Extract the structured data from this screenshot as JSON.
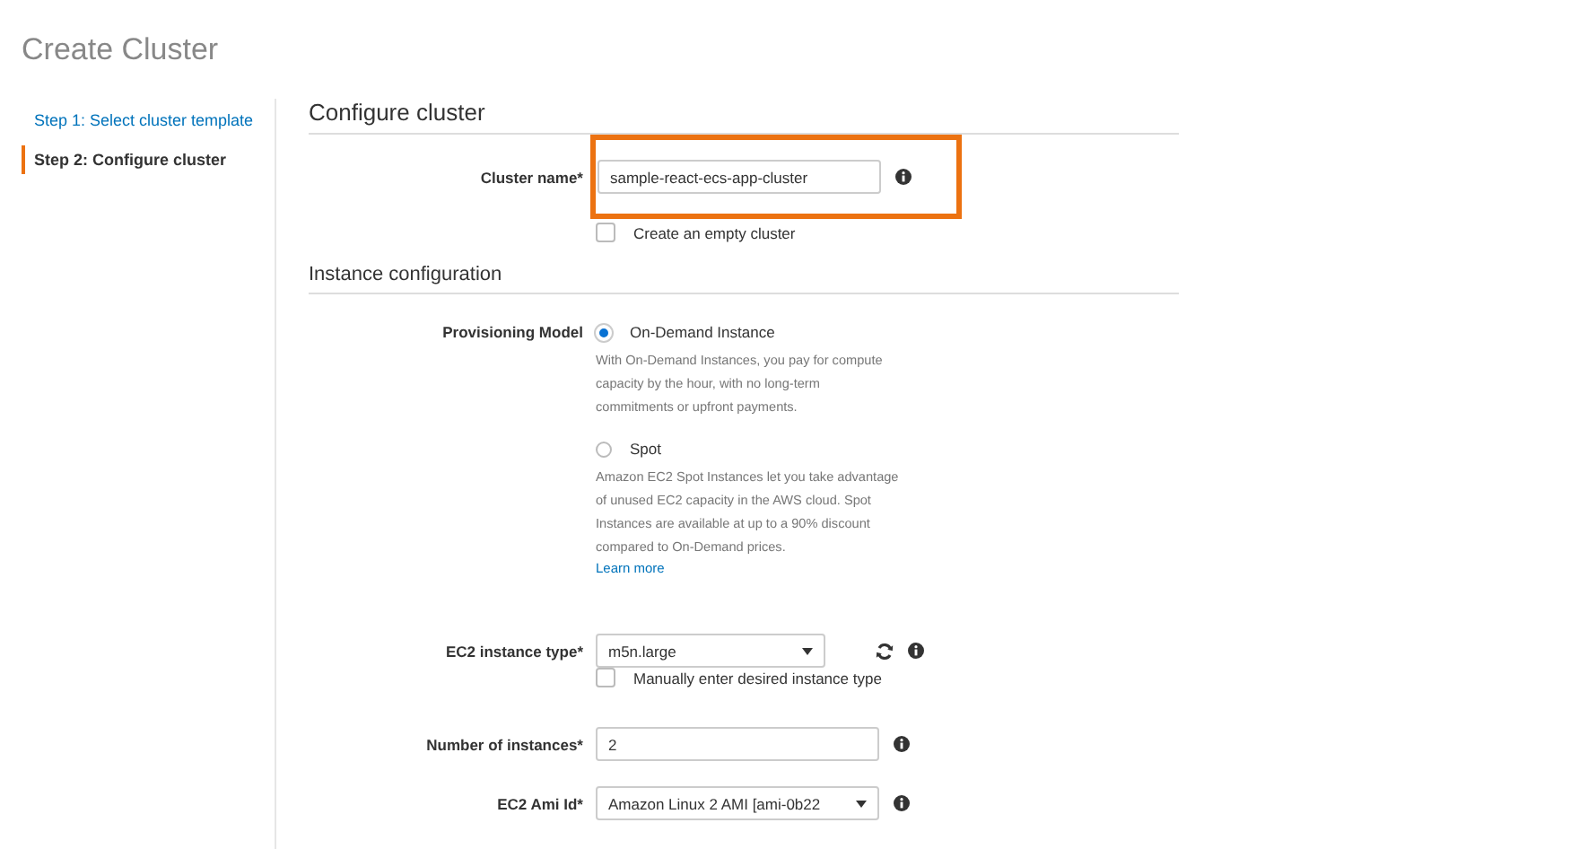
{
  "page_title": "Create Cluster",
  "steps": [
    {
      "label": "Step 1: Select cluster template",
      "selected": false
    },
    {
      "label": "Step 2: Configure cluster",
      "selected": true
    }
  ],
  "section_title": "Configure cluster",
  "cluster_name": {
    "label": "Cluster name*",
    "value": "sample-react-ecs-app-cluster",
    "highlighted": true
  },
  "empty_cluster": {
    "label": "Create an empty cluster",
    "checked": false
  },
  "instance_section_title": "Instance configuration",
  "provisioning": {
    "label": "Provisioning Model",
    "options": [
      {
        "label": "On-Demand Instance",
        "selected": true,
        "description": "With On-Demand Instances, you pay for compute capacity by the hour, with no long-term commitments or upfront payments."
      },
      {
        "label": "Spot",
        "selected": false,
        "description": "Amazon EC2 Spot Instances let you take advantage of unused EC2 capacity in the AWS cloud. Spot Instances are available at up to a 90% discount compared to On-Demand prices.",
        "link": "Learn more"
      }
    ]
  },
  "instance_type": {
    "label": "EC2 instance type*",
    "value": "m5n.large",
    "manual": {
      "label": "Manually enter desired instance type",
      "checked": false
    }
  },
  "instance_count": {
    "label": "Number of instances*",
    "value": "2"
  },
  "ami": {
    "label": "EC2 Ami Id*",
    "value": "Amazon Linux 2 AMI [ami-0b22"
  }
}
